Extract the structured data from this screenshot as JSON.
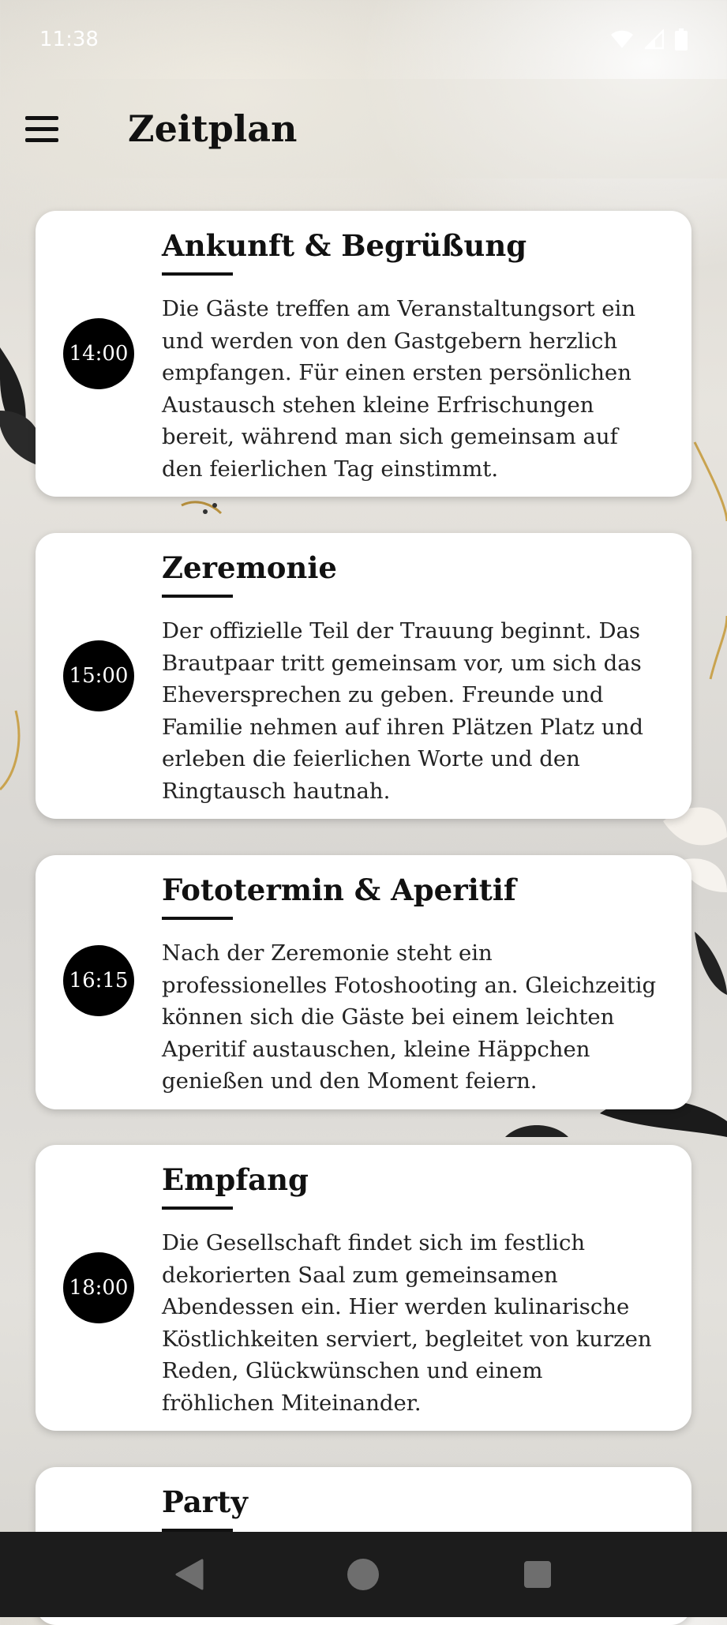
{
  "status_bar": {
    "time": "11:38"
  },
  "header": {
    "title": "Zeitplan",
    "menu_icon": "menu-icon"
  },
  "events": [
    {
      "time": "14:00",
      "title": "Ankunft & Begrüßung",
      "description": "Die Gäste treffen am Veranstaltungsort ein und werden von den Gastgebern herzlich empfangen. Für einen ersten persönlichen Austausch stehen kleine Erfrischungen bereit, während man sich gemeinsam auf den feierlichen Tag einstimmt."
    },
    {
      "time": "15:00",
      "title": "Zeremonie",
      "description": "Der offizielle Teil der Trauung beginnt. Das Brautpaar tritt gemeinsam vor, um sich das Eheversprechen zu geben. Freunde und Familie nehmen auf ihren Plätzen Platz und erleben die feierlichen Worte und den Ringtausch hautnah."
    },
    {
      "time": "16:15",
      "title": "Fototermin & Aperitif",
      "description": "Nach der Zeremonie steht ein professionelles Fotoshooting an. Gleichzeitig können sich die Gäste bei einem leichten Aperitif austauschen, kleine Häppchen genießen und den Moment feiern."
    },
    {
      "time": "18:00",
      "title": "Empfang",
      "description": "Die Gesellschaft findet sich im festlich dekorierten Saal zum gemeinsamen Abendessen ein. Hier werden kulinarische Köstlichkeiten serviert, begleitet von kurzen Reden, Glückwünschen und einem fröhlichen Miteinander."
    },
    {
      "time": "",
      "title": "Party",
      "description": ""
    }
  ],
  "nav": {
    "back_icon": "back-icon",
    "home_icon": "home-icon",
    "recents_icon": "recents-icon"
  },
  "colors": {
    "badge": "#000000",
    "card": "#ffffff",
    "nav_bar": "#1c1c1c"
  }
}
